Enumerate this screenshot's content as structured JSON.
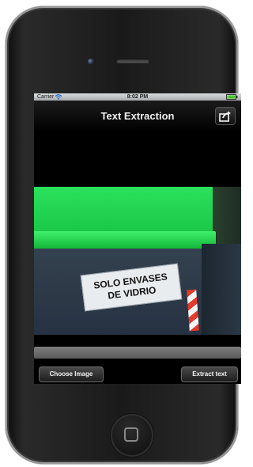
{
  "status_bar": {
    "carrier": "Carrier",
    "time": "8:02 PM"
  },
  "nav": {
    "title": "Text Extraction",
    "share_icon": "share-icon"
  },
  "photo": {
    "sticker_line1": "SOLO ENVASES",
    "sticker_line2": "DE VIDRIO"
  },
  "buttons": {
    "choose_image": "Choose Image",
    "extract_text": "Extract text"
  },
  "colors": {
    "bin_green": "#1ac647",
    "bin_body": "#2f3a47",
    "toolbar": "#000000"
  }
}
